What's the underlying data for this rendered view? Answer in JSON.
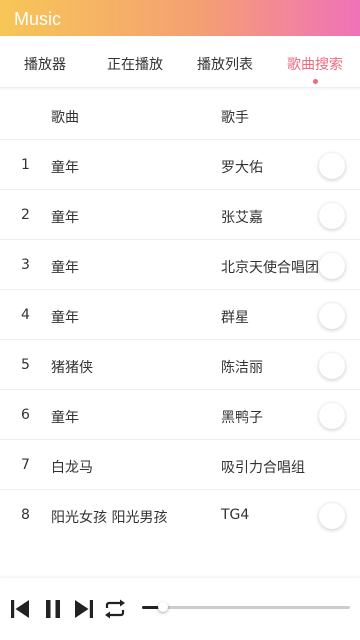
{
  "app": {
    "title": "Music"
  },
  "tabs": [
    {
      "label": "播放器",
      "active": false
    },
    {
      "label": "正在播放",
      "active": false
    },
    {
      "label": "播放列表",
      "active": false
    },
    {
      "label": "歌曲搜索",
      "active": true
    }
  ],
  "table": {
    "headers": {
      "song": "歌曲",
      "artist": "歌手"
    },
    "rows": [
      {
        "num": "1",
        "song": "童年",
        "artist": "罗大佑"
      },
      {
        "num": "2",
        "song": "童年",
        "artist": "张艾嘉"
      },
      {
        "num": "3",
        "song": "童年",
        "artist": "北京天使合唱团"
      },
      {
        "num": "4",
        "song": "童年",
        "artist": "群星"
      },
      {
        "num": "5",
        "song": "猪猪侠",
        "artist": "陈洁丽"
      },
      {
        "num": "6",
        "song": "童年",
        "artist": "黑鸭子"
      },
      {
        "num": "7",
        "song": "白龙马",
        "artist": "吸引力合唱组"
      },
      {
        "num": "8",
        "song": "阳光女孩 阳光男孩",
        "artist": "TG4"
      }
    ]
  },
  "player": {
    "controls": [
      "skip-previous-icon",
      "pause-icon",
      "skip-next-icon",
      "repeat-icon"
    ],
    "progress_fraction": 0.1
  },
  "colors": {
    "accent": "#f06a7d",
    "gradient_start": "#f7c657",
    "gradient_end": "#f072b9"
  }
}
